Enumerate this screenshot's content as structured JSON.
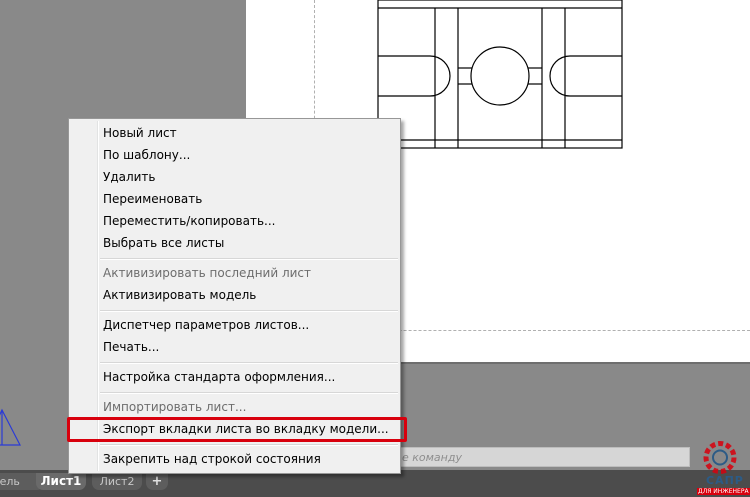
{
  "menu": {
    "items": [
      {
        "label": "Новый лист",
        "enabled": true
      },
      {
        "label": "По шаблону...",
        "enabled": true
      },
      {
        "label": "Удалить",
        "enabled": true
      },
      {
        "label": "Переименовать",
        "enabled": true
      },
      {
        "label": "Переместить/копировать...",
        "enabled": true
      },
      {
        "label": "Выбрать все листы",
        "enabled": true
      },
      {
        "label": "Активизировать последний лист",
        "enabled": false
      },
      {
        "label": "Активизировать модель",
        "enabled": true
      },
      {
        "label": "Диспетчер параметров листов...",
        "enabled": true
      },
      {
        "label": "Печать...",
        "enabled": true
      },
      {
        "label": "Настройка стандарта оформления...",
        "enabled": true
      },
      {
        "label": "Импортировать лист...",
        "enabled": false
      },
      {
        "label": "Экспорт вкладки листа во вкладку модели...",
        "enabled": true
      },
      {
        "label": "Закрепить над строкой состояния",
        "enabled": true
      }
    ]
  },
  "command_line": {
    "placeholder": "е команду"
  },
  "tabs": {
    "model": "дель",
    "active": "Лист1",
    "second": "Лист2",
    "add": "+"
  },
  "watermark": {
    "title": "САПР",
    "subtitle": "ДЛЯ ИНЖЕНЕРА"
  },
  "colors": {
    "highlight": "#d8000d",
    "background": "#898989"
  }
}
